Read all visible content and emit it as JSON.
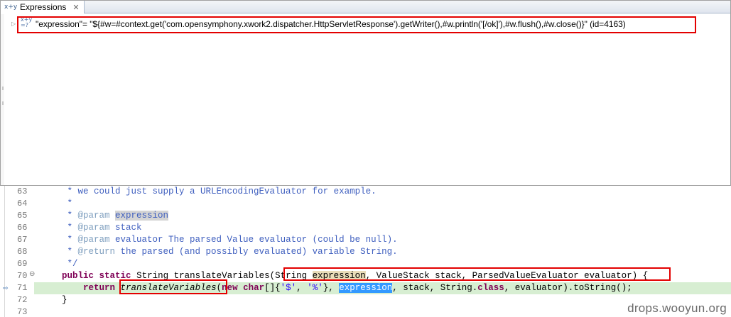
{
  "expressions_view": {
    "tab_label": "Expressions",
    "tab_icon": "expressions-icon",
    "close_icon": "close-icon",
    "expand_icon": "expand-arrow-icon",
    "variable_icon_top": "x+y",
    "variable_icon_bottom": "=?",
    "expression": "\"expression\"= \"${#w=#context.get('com.opensymphony.xwork2.dispatcher.HttpServletResponse').getWriter(),#w.println('[/ok]'),#w.flush(),#w.close()}\" (id=4163)"
  },
  "editor": {
    "lines": [
      {
        "num": "63",
        "text": "     * we could just supply a URLEncodingEvaluator for example."
      },
      {
        "num": "64",
        "text": "     *"
      },
      {
        "num": "65",
        "prefix": "     * ",
        "tag": "@param",
        "sp": " ",
        "param": "expression"
      },
      {
        "num": "66",
        "prefix": "     * ",
        "tag": "@param",
        "rest": " stack"
      },
      {
        "num": "67",
        "prefix": "     * ",
        "tag": "@param",
        "rest": " evaluator The parsed Value evaluator (could be null)."
      },
      {
        "num": "68",
        "prefix": "     * ",
        "tag": "@return",
        "rest": " the parsed (and possibly evaluated) variable String."
      },
      {
        "num": "69",
        "text": "     */"
      },
      {
        "num": "70",
        "indent": "    ",
        "kw1": "public",
        "kw2": "static",
        "pre": " String translateVariables(String ",
        "occ": "expression",
        "post": ", ValueStack stack, ParsedValueEvaluator evaluator) {"
      },
      {
        "num": "71",
        "indent": "        ",
        "kw": "return",
        "call": "translateVariables",
        "pre": "(",
        "kw2": "new",
        "mid1": " ",
        "kw3": "char",
        "mid2": "[]{",
        "s1": "'$'",
        "comma": ", ",
        "s2": "'%'",
        "mid3": "}, ",
        "sel": "expression",
        "mid4": ", stack, String.",
        "kw4": "class",
        "end": ", evaluator).toString();"
      },
      {
        "num": "72",
        "text": "    }"
      },
      {
        "num": "73",
        "text": ""
      }
    ],
    "fold_icon": "fold-minus-icon",
    "current_line_icon": "current-instruction-icon"
  },
  "watermark": "drops.wooyun.org",
  "colors": {
    "highlight_border": "#e30000",
    "selection": "#3399ff",
    "current_line": "#d7eed2",
    "keyword": "#7f0055",
    "comment": "#3f5fbf"
  }
}
